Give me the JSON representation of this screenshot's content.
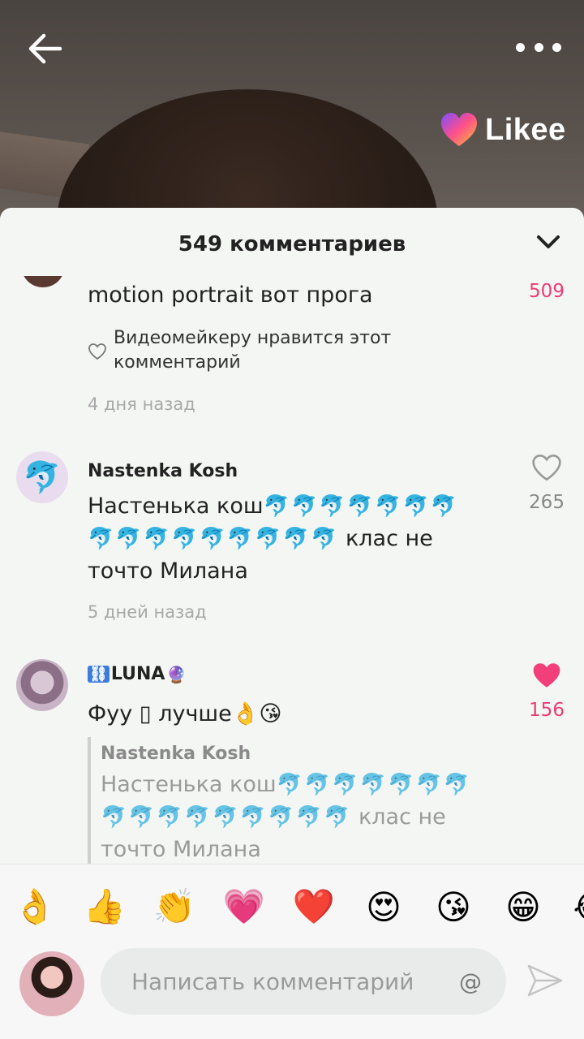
{
  "brand": {
    "name": "Likee"
  },
  "panel": {
    "title": "549 комментариев"
  },
  "comments": [
    {
      "text": "motion portrait вот прога",
      "liked_by_creator": "Видеомейкеру нравится этот комментарий",
      "time": "4 дня назад",
      "likes": "509",
      "liked": true
    },
    {
      "name": "Nastenka Kosh",
      "text_prefix": "Настенька кош",
      "dolphins_line1": "🐬🐬🐬🐬🐬🐬🐬",
      "dolphins_line2": "🐬🐬🐬🐬🐬🐬🐬🐬🐬",
      "text_suffix": "клас не",
      "text_line3": "точто Милана",
      "time": "5 дней назад",
      "likes": "265",
      "liked": false
    },
    {
      "name_icon": "⛓",
      "name": "LUNA",
      "name_badge": "🔮",
      "text": "Фуу ▯ лучше👌😘",
      "likes": "156",
      "liked": true,
      "reply": {
        "name": "Nastenka Kosh",
        "text_prefix": "Настенька кош",
        "dolphins_line1": "🐬🐬🐬🐬🐬🐬🐬",
        "dolphins_line2": "🐬🐬🐬🐬🐬🐬🐬🐬🐬",
        "text_suffix": "клас не",
        "text_line3": "точто Милана"
      }
    }
  ],
  "emoji_bar": [
    "👌",
    "👍",
    "👏",
    "💗",
    "❤️",
    "😍",
    "😘",
    "😁",
    "😂"
  ],
  "input": {
    "placeholder": "Написать комментарий",
    "at_symbol": "@"
  },
  "colors": {
    "accent_pink": "#ee3a78",
    "panel_bg": "#f4f6f4"
  }
}
